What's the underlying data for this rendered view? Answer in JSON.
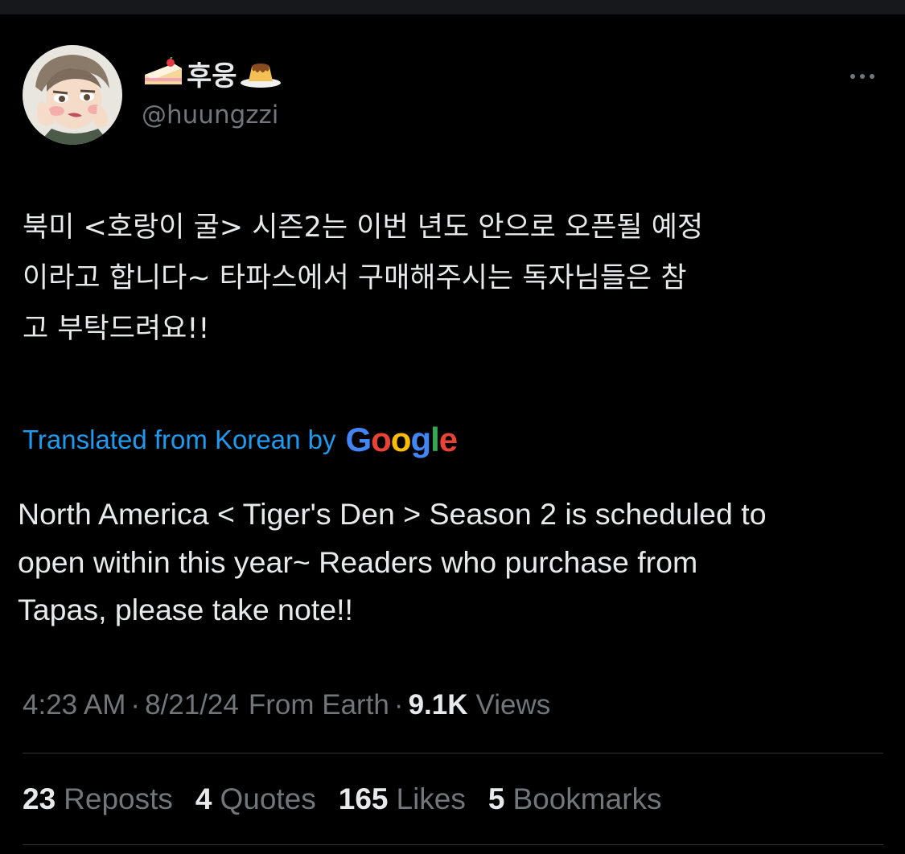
{
  "user": {
    "display_name": "후웅",
    "handle": "@huungzzi",
    "name_emoji_left": "cake-slice-icon",
    "name_emoji_right": "pudding-icon"
  },
  "tweet": {
    "text_lines": [
      "북미 <호랑이 굴> 시즌2는 이번 년도 안으로 오픈될 예정",
      "이라고 합니다~ 타파스에서 구매해주시는 독자님들은 참",
      "고 부탁드려요!!"
    ],
    "translated_label": "Translated from Korean by",
    "translator": "Google",
    "translation_lines": [
      "North America < Tiger's Den > Season 2 is scheduled to",
      "open within this year~ Readers who purchase from",
      "Tapas, please take note!!"
    ]
  },
  "meta": {
    "time": "4:23 AM",
    "separator": "·",
    "date": "8/21/24",
    "source": "From Earth",
    "views_count": "9.1K",
    "views_label": "Views"
  },
  "stats": [
    {
      "count": "23",
      "label": "Reposts"
    },
    {
      "count": "4",
      "label": "Quotes"
    },
    {
      "count": "165",
      "label": "Likes"
    },
    {
      "count": "5",
      "label": "Bookmarks"
    }
  ],
  "colors": {
    "background": "#000000",
    "text": "#e7e9ea",
    "secondary": "#71767b",
    "link": "#1d9bf0",
    "divider": "#2f3336",
    "google_blue": "#4285f4",
    "google_red": "#ea4335",
    "google_yellow": "#fbbc05",
    "google_green": "#34a853"
  }
}
